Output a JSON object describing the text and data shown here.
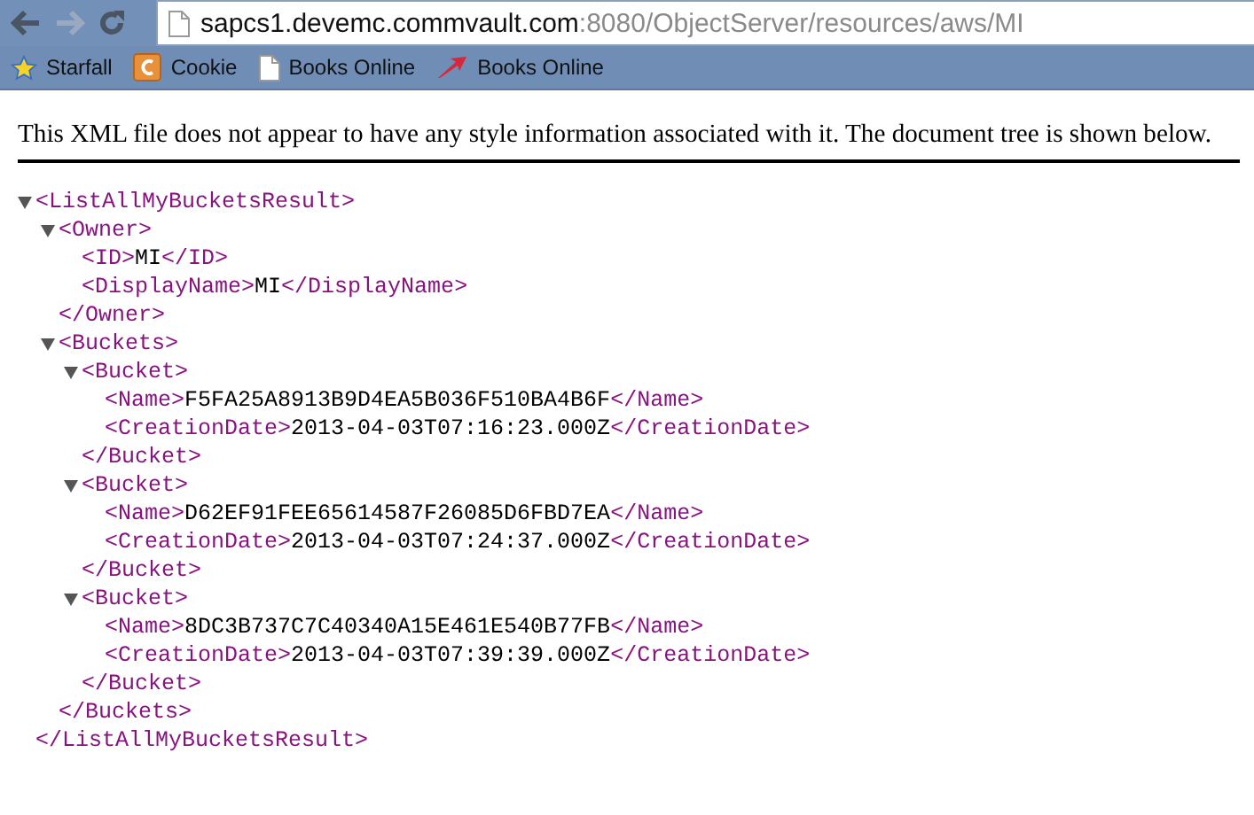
{
  "browser": {
    "url_host": "sapcs1.devemc.commvault.com",
    "url_rest": ":8080/ObjectServer/resources/aws/MI",
    "bookmarks": [
      {
        "label": "Starfall",
        "kind": "star"
      },
      {
        "label": "Cookie",
        "kind": "cookie"
      },
      {
        "label": "Books Online",
        "kind": "page"
      },
      {
        "label": "Books Online",
        "kind": "arrow"
      }
    ]
  },
  "notice": "This XML file does not appear to have any style information associated with it. The document tree is shown below.",
  "xml_tree": {
    "kind": "element",
    "open_tag": "<ListAllMyBucketsResult>",
    "expanded": true,
    "close_tag": "</ListAllMyBucketsResult>",
    "children": [
      {
        "kind": "element",
        "open_tag": "<Owner>",
        "expanded": true,
        "close_tag": "</Owner>",
        "children": [
          {
            "kind": "leaf",
            "open_tag": "<ID>",
            "text": "MI",
            "close_tag": "</ID>"
          },
          {
            "kind": "leaf",
            "open_tag": "<DisplayName>",
            "text": "MI",
            "close_tag": "</DisplayName>"
          }
        ]
      },
      {
        "kind": "element",
        "open_tag": "<Buckets>",
        "expanded": true,
        "close_tag": "</Buckets>",
        "children": [
          {
            "kind": "element",
            "open_tag": "<Bucket>",
            "expanded": true,
            "close_tag": "</Bucket>",
            "children": [
              {
                "kind": "leaf",
                "open_tag": "<Name>",
                "text": "F5FA25A8913B9D4EA5B036F510BA4B6F",
                "close_tag": "</Name>"
              },
              {
                "kind": "leaf",
                "open_tag": "<CreationDate>",
                "text": "2013-04-03T07:16:23.000Z",
                "close_tag": "</CreationDate>"
              }
            ]
          },
          {
            "kind": "element",
            "open_tag": "<Bucket>",
            "expanded": true,
            "close_tag": "</Bucket>",
            "children": [
              {
                "kind": "leaf",
                "open_tag": "<Name>",
                "text": "D62EF91FEE65614587F26085D6FBD7EA",
                "close_tag": "</Name>"
              },
              {
                "kind": "leaf",
                "open_tag": "<CreationDate>",
                "text": "2013-04-03T07:24:37.000Z",
                "close_tag": "</CreationDate>"
              }
            ]
          },
          {
            "kind": "element",
            "open_tag": "<Bucket>",
            "expanded": true,
            "close_tag": "</Bucket>",
            "children": [
              {
                "kind": "leaf",
                "open_tag": "<Name>",
                "text": "8DC3B737C7C40340A15E461E540B77FB",
                "close_tag": "</Name>"
              },
              {
                "kind": "leaf",
                "open_tag": "<CreationDate>",
                "text": "2013-04-03T07:39:39.000Z",
                "close_tag": "</CreationDate>"
              }
            ]
          }
        ]
      }
    ]
  }
}
